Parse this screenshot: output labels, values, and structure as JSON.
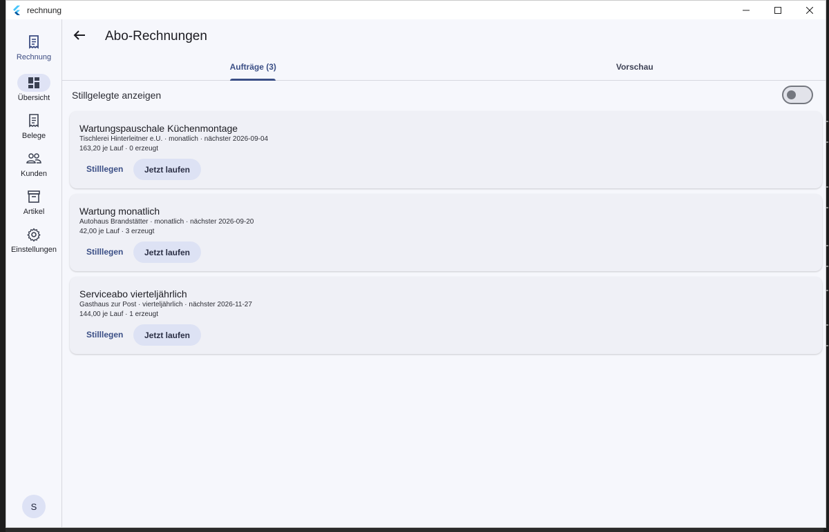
{
  "window": {
    "title": "rechnung"
  },
  "rail": {
    "items": [
      {
        "label": "Rechnung",
        "icon": "receipt-icon"
      },
      {
        "label": "Übersicht",
        "icon": "dashboard-icon"
      },
      {
        "label": "Belege",
        "icon": "document-icon"
      },
      {
        "label": "Kunden",
        "icon": "people-icon"
      },
      {
        "label": "Artikel",
        "icon": "archive-icon"
      },
      {
        "label": "Einstellungen",
        "icon": "gear-icon"
      }
    ],
    "avatar": "S"
  },
  "header": {
    "title": "Abo-Rechnungen"
  },
  "tabs": [
    {
      "label": "Aufträge (3)",
      "active": true
    },
    {
      "label": "Vorschau",
      "active": false
    }
  ],
  "filter": {
    "label": "Stillgelegte anzeigen",
    "enabled": false
  },
  "subscriptions": [
    {
      "title": "Wartungspauschale Küchenmontage",
      "subtitle": "Tischlerei Hinterleitner e.U. · monatlich · nächster 2026-09-04",
      "meta": "163,20 je Lauf · 0 erzeugt",
      "pause_label": "Stilllegen",
      "run_label": "Jetzt laufen"
    },
    {
      "title": "Wartung monatlich",
      "subtitle": "Autohaus Brandstätter · monatlich · nächster 2026-09-20",
      "meta": "42,00 je Lauf · 3 erzeugt",
      "pause_label": "Stilllegen",
      "run_label": "Jetzt laufen"
    },
    {
      "title": "Serviceabo vierteljährlich",
      "subtitle": "Gasthaus zur Post · vierteljährlich · nächster 2026-11-27",
      "meta": "144,00 je Lauf · 1 erzeugt",
      "pause_label": "Stilllegen",
      "run_label": "Jetzt laufen"
    }
  ],
  "colors": {
    "accent": "#3b4f86",
    "tonal": "#dde2f4",
    "background": "#f6f7fc"
  }
}
